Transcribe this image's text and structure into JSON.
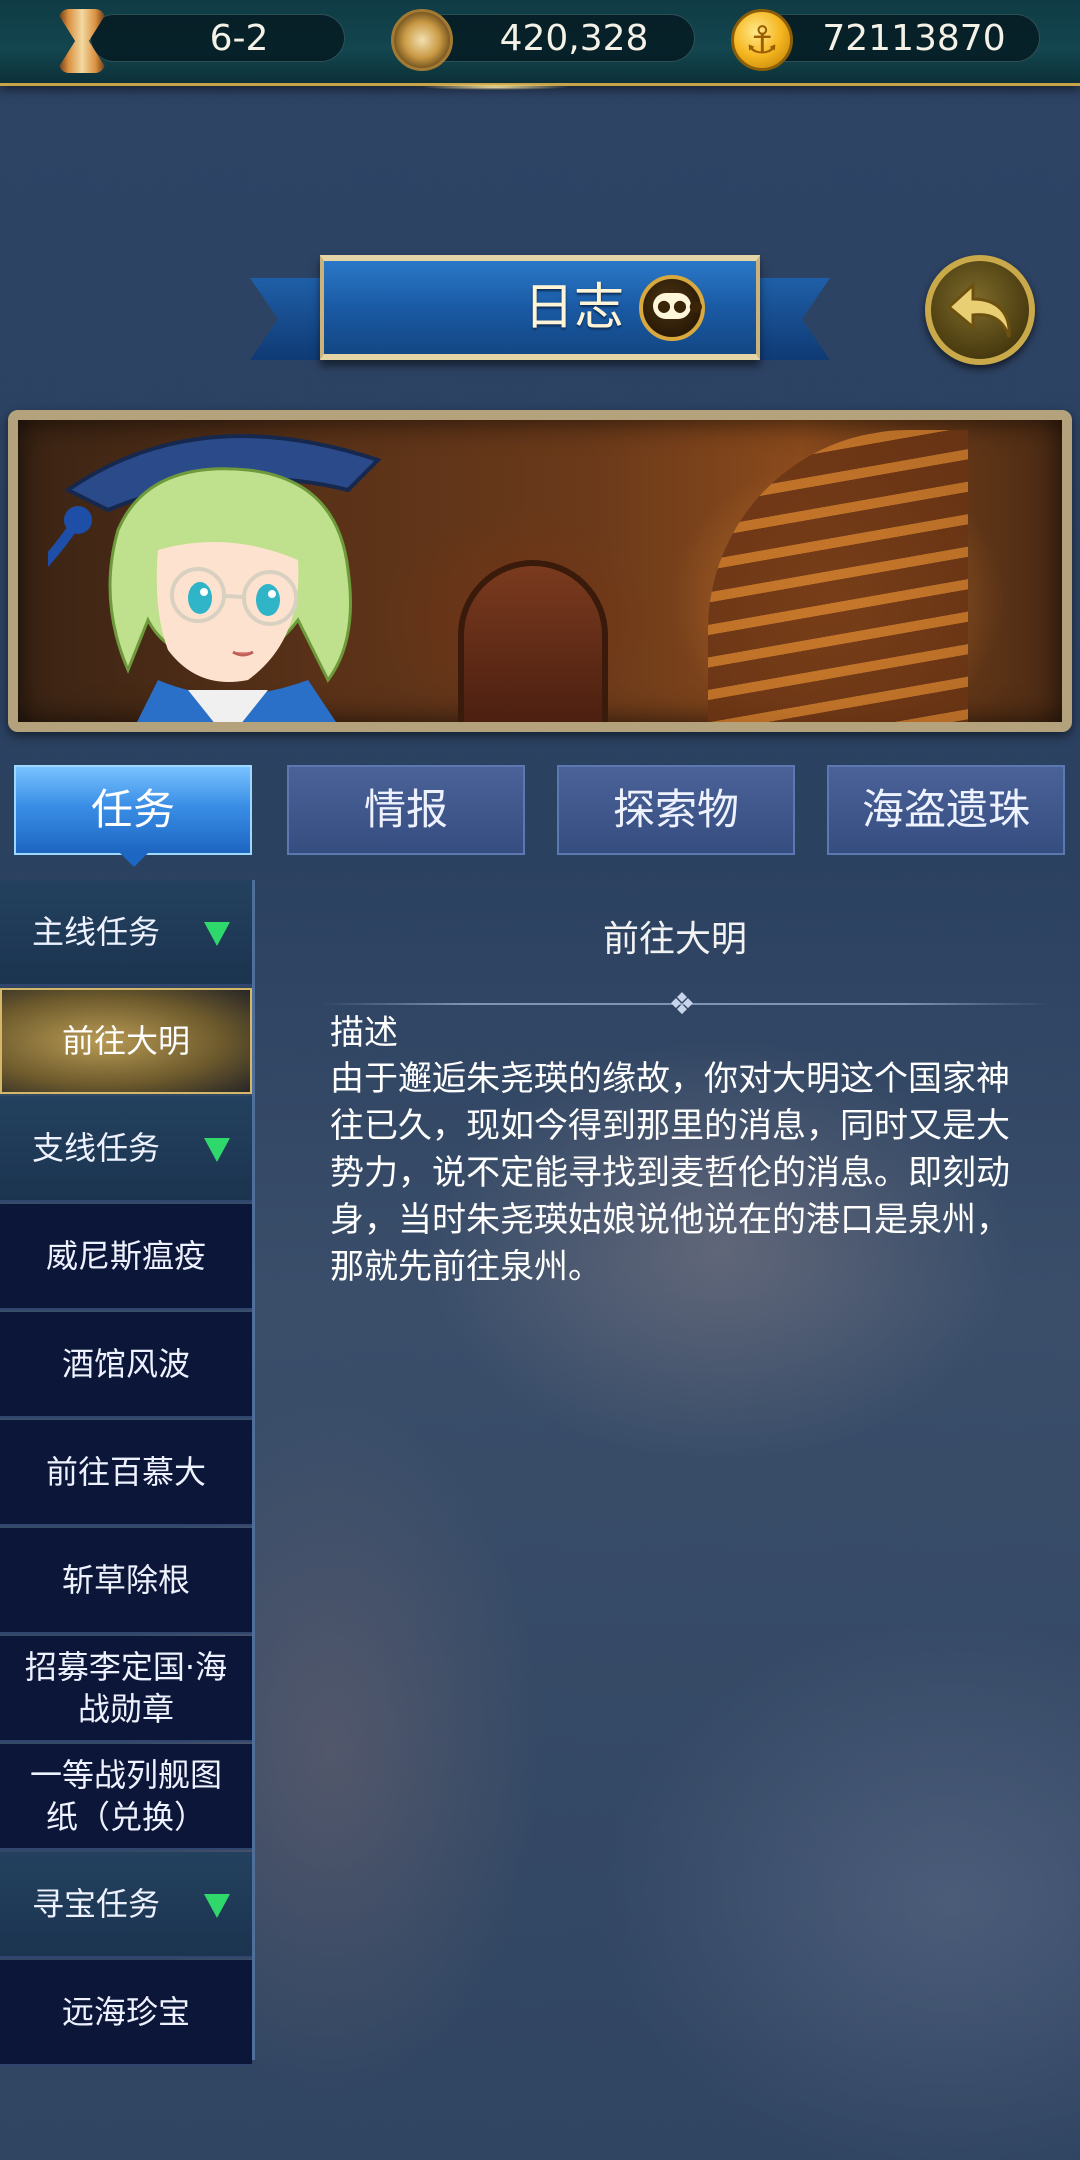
{
  "topbar": {
    "stage": "6-2",
    "compass_value": "420,328",
    "gold_value": "72113870"
  },
  "header": {
    "title": "日志"
  },
  "tabs": [
    {
      "label": "任务",
      "active": true
    },
    {
      "label": "情报",
      "active": false
    },
    {
      "label": "探索物",
      "active": false
    },
    {
      "label": "海盗遗珠",
      "active": false
    }
  ],
  "sidebar": {
    "items": [
      {
        "label": "主线任务",
        "type": "category"
      },
      {
        "label": "前往大明",
        "type": "selected"
      },
      {
        "label": "支线任务",
        "type": "category"
      },
      {
        "label": "威尼斯瘟疫",
        "type": "item"
      },
      {
        "label": "酒馆风波",
        "type": "item"
      },
      {
        "label": "前往百慕大",
        "type": "item"
      },
      {
        "label": "斩草除根",
        "type": "item"
      },
      {
        "label": "招募李定国·海战勋章",
        "type": "item"
      },
      {
        "label": "一等战列舰图纸（兑换）",
        "type": "item"
      },
      {
        "label": "寻宝任务",
        "type": "category"
      },
      {
        "label": "远海珍宝",
        "type": "item"
      }
    ]
  },
  "detail": {
    "title": "前往大明",
    "desc_label": "描述",
    "description": "由于邂逅朱尧瑛的缘故，你对大明这个国家神往已久，现如今得到那里的消息，同时又是大势力，说不定能寻找到麦哲伦的消息。即刻动身，当时朱尧瑛姑娘说他说在的港口是泉州，那就先前往泉州。"
  },
  "colors": {
    "tab_active": "#3a8ee6",
    "tab_inactive": "#364d80",
    "category_arrow": "#2fd86a",
    "gold_accent": "#c8a34a"
  }
}
